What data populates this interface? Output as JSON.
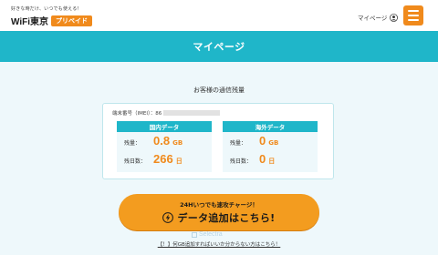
{
  "header": {
    "tagline": "好きな時だけ、いつでも使える！",
    "logo_text": "WiFi東京",
    "logo_badge": "プリペイド",
    "mypage_link": "マイページ"
  },
  "title": "マイページ",
  "usage": {
    "section_title": "お客様の通信残量",
    "imei_label": "端末番号（IMEI）：86",
    "domestic": {
      "heading": "国内データ",
      "remaining_label": "残量：",
      "remaining_value": "0.8",
      "remaining_unit": "GB",
      "days_label": "残日数：",
      "days_value": "266",
      "days_unit": "日"
    },
    "overseas": {
      "heading": "海外データ",
      "remaining_label": "残量：",
      "remaining_value": "0",
      "remaining_unit": "GB",
      "days_label": "残日数：",
      "days_value": "0",
      "days_unit": "日"
    }
  },
  "cta": {
    "sub_label": "24Hいつでも速攻チャージ！",
    "main_label": "データ追加はこちら!"
  },
  "watermark": "Selectra",
  "help_link": "【！】何GB追加すればいいか分からない方はこちら！",
  "colors": {
    "accent": "#1fb6c9",
    "brand_orange": "#f08a1c",
    "content_bg": "#eef8fb"
  },
  "icons": {
    "user": "user-circle-icon",
    "menu": "hamburger-menu-icon",
    "bolt": "lightning-bolt-icon"
  }
}
